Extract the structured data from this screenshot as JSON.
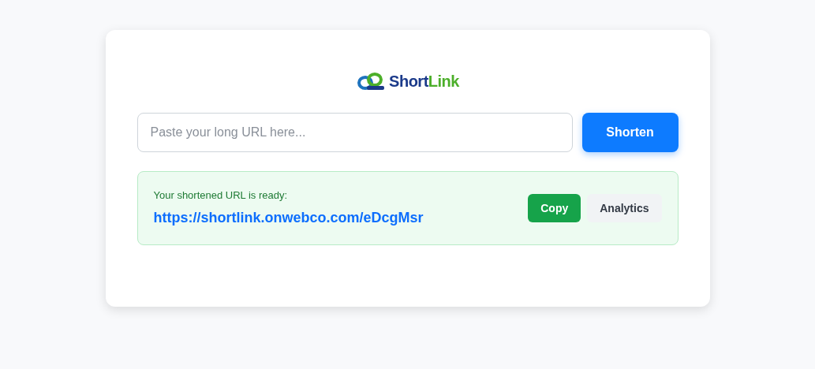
{
  "logo": {
    "name_start": "Short",
    "name_end": "Link"
  },
  "url_field": {
    "placeholder": "Paste your long URL here..."
  },
  "shorten_button": "Shorten",
  "result": {
    "label": "Your shortened URL is ready:",
    "url": "https://shortlink.onwebco.com/eDcgMsr",
    "buttons": [
      {
        "kind": "primary",
        "label": "Copy"
      },
      {
        "kind": "secondary",
        "label": "Analytics"
      }
    ]
  }
}
